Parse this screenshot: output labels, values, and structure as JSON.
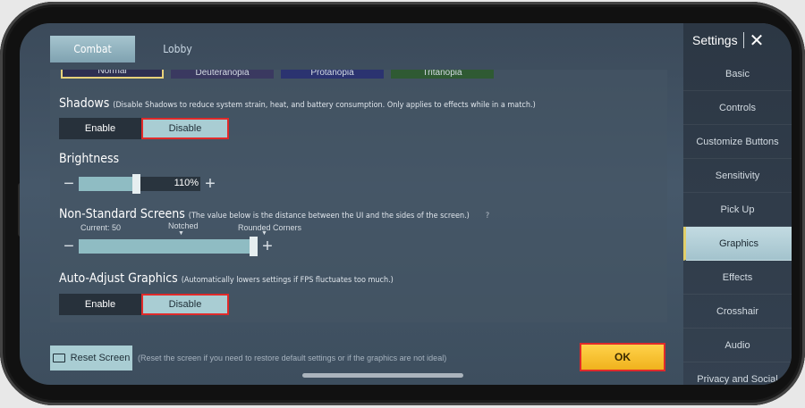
{
  "tabs": [
    {
      "label": "Combat",
      "active": true
    },
    {
      "label": "Lobby",
      "active": false
    }
  ],
  "colorblind_options": [
    "Normal",
    "Deuteranopia",
    "Protanopia",
    "Tritanopia"
  ],
  "shadows": {
    "title": "Shadows",
    "note": "(Disable Shadows to reduce system strain, heat, and battery consumption. Only applies to effects while in a match.)",
    "options": [
      "Enable",
      "Disable"
    ],
    "selected": "Disable"
  },
  "brightness": {
    "title": "Brightness",
    "value_text": "110%",
    "value": 0.48
  },
  "screens": {
    "title": "Non-Standard Screens",
    "note": "(The value below is the distance between the UI and the sides of the screen.)",
    "help": "?",
    "current_label": "Current: 50",
    "notched_label": "Notched",
    "rounded_label": "Rounded Corners",
    "value": 1.0
  },
  "auto_adjust": {
    "title": "Auto-Adjust Graphics",
    "note": "(Automatically lowers settings if FPS fluctuates too much.)",
    "options": [
      "Enable",
      "Disable"
    ],
    "selected": "Disable"
  },
  "bottom": {
    "reset_label": "Reset Screen",
    "reset_note": "(Reset the screen if you need to restore default settings or if the graphics are not ideal)",
    "ok_label": "OK"
  },
  "sidebar": {
    "title": "Settings",
    "close": "✕",
    "items": [
      {
        "label": "Basic"
      },
      {
        "label": "Controls"
      },
      {
        "label": "Customize Buttons"
      },
      {
        "label": "Sensitivity"
      },
      {
        "label": "Pick Up"
      },
      {
        "label": "Graphics"
      },
      {
        "label": "Effects"
      },
      {
        "label": "Crosshair"
      },
      {
        "label": "Audio"
      },
      {
        "label": "Privacy and Social"
      }
    ],
    "active": "Graphics"
  },
  "colors": {
    "accent_teal": "#a9cdd3",
    "ok_yellow": "#f0b21d",
    "highlight_red": "#e02a2a"
  }
}
